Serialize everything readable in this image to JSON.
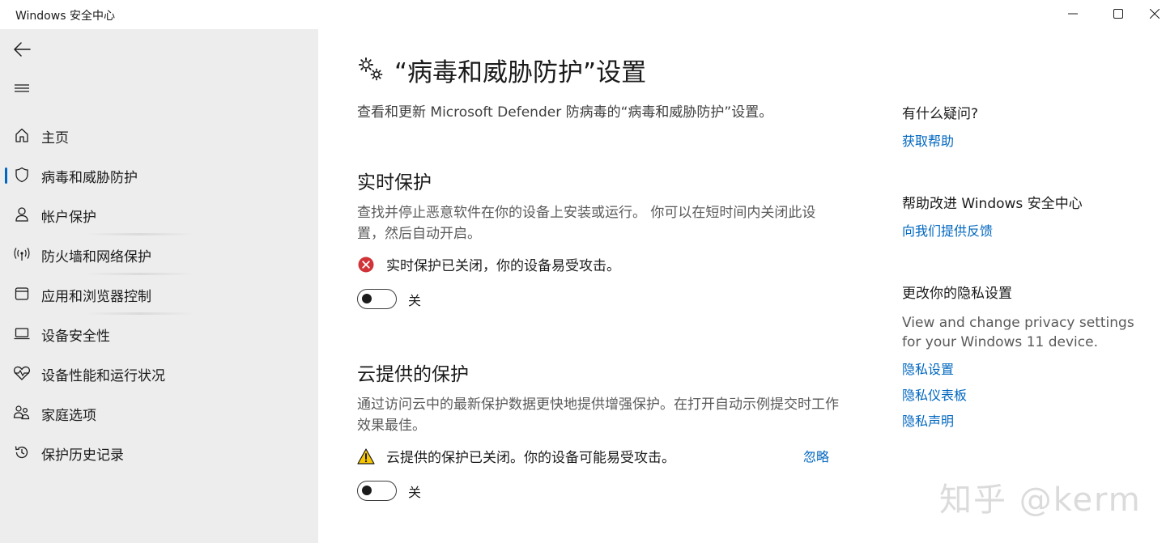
{
  "window": {
    "title": "Windows 安全中心",
    "controls": [
      "minimize",
      "maximize",
      "close"
    ]
  },
  "sidebar": {
    "back_icon": "back-arrow-icon",
    "menu_icon": "hamburger-icon",
    "items": [
      {
        "label": "主页",
        "icon": "home-icon",
        "active": false
      },
      {
        "label": "病毒和威胁防护",
        "icon": "shield-icon",
        "active": true
      },
      {
        "label": "帐户保护",
        "icon": "person-icon",
        "active": false
      },
      {
        "label": "防火墙和网络保护",
        "icon": "wifi-antenna-icon",
        "active": false
      },
      {
        "label": "应用和浏览器控制",
        "icon": "browser-window-icon",
        "active": false
      },
      {
        "label": "设备安全性",
        "icon": "laptop-icon",
        "active": false
      },
      {
        "label": "设备性能和运行状况",
        "icon": "heart-pulse-icon",
        "active": false
      },
      {
        "label": "家庭选项",
        "icon": "family-icon",
        "active": false
      },
      {
        "label": "保护历史记录",
        "icon": "history-icon",
        "active": false
      }
    ]
  },
  "main": {
    "title": "“病毒和威胁防护”设置",
    "description": "查看和更新 Microsoft Defender 防病毒的“病毒和威胁防护”设置。",
    "sections": [
      {
        "heading": "实时保护",
        "description": "查找并停止恶意软件在你的设备上安装或运行。 你可以在短时间内关闭此设置，然后自动开启。",
        "status_text": "实时保护已关闭，你的设备易受攻击。",
        "status_icon": "error-x-icon",
        "toggle_label": "关",
        "toggle_on": false
      },
      {
        "heading": "云提供的保护",
        "description": "通过访问云中的最新保护数据更快地提供增强保护。在打开自动示例提交时工作效果最佳。",
        "status_text": "云提供的保护已关闭。你的设备可能易受攻击。",
        "status_icon": "warning-triangle-icon",
        "dismiss_label": "忽略",
        "toggle_label": "关",
        "toggle_on": false
      }
    ]
  },
  "side_panel": {
    "question_heading": "有什么疑问?",
    "help_link": "获取帮助",
    "improve_heading": "帮助改进 Windows 安全中心",
    "feedback_link": "向我们提供反馈",
    "privacy_heading": "更改你的隐私设置",
    "privacy_text": "View and change privacy settings for your Windows 11 device.",
    "privacy_links": [
      "隐私设置",
      "隐私仪表板",
      "隐私声明"
    ]
  },
  "watermark": "知乎 @kerm",
  "colors": {
    "accent": "#0067c0",
    "sidebar_bg": "#ededed",
    "error": "#d13438",
    "warning": "#f7c600"
  }
}
